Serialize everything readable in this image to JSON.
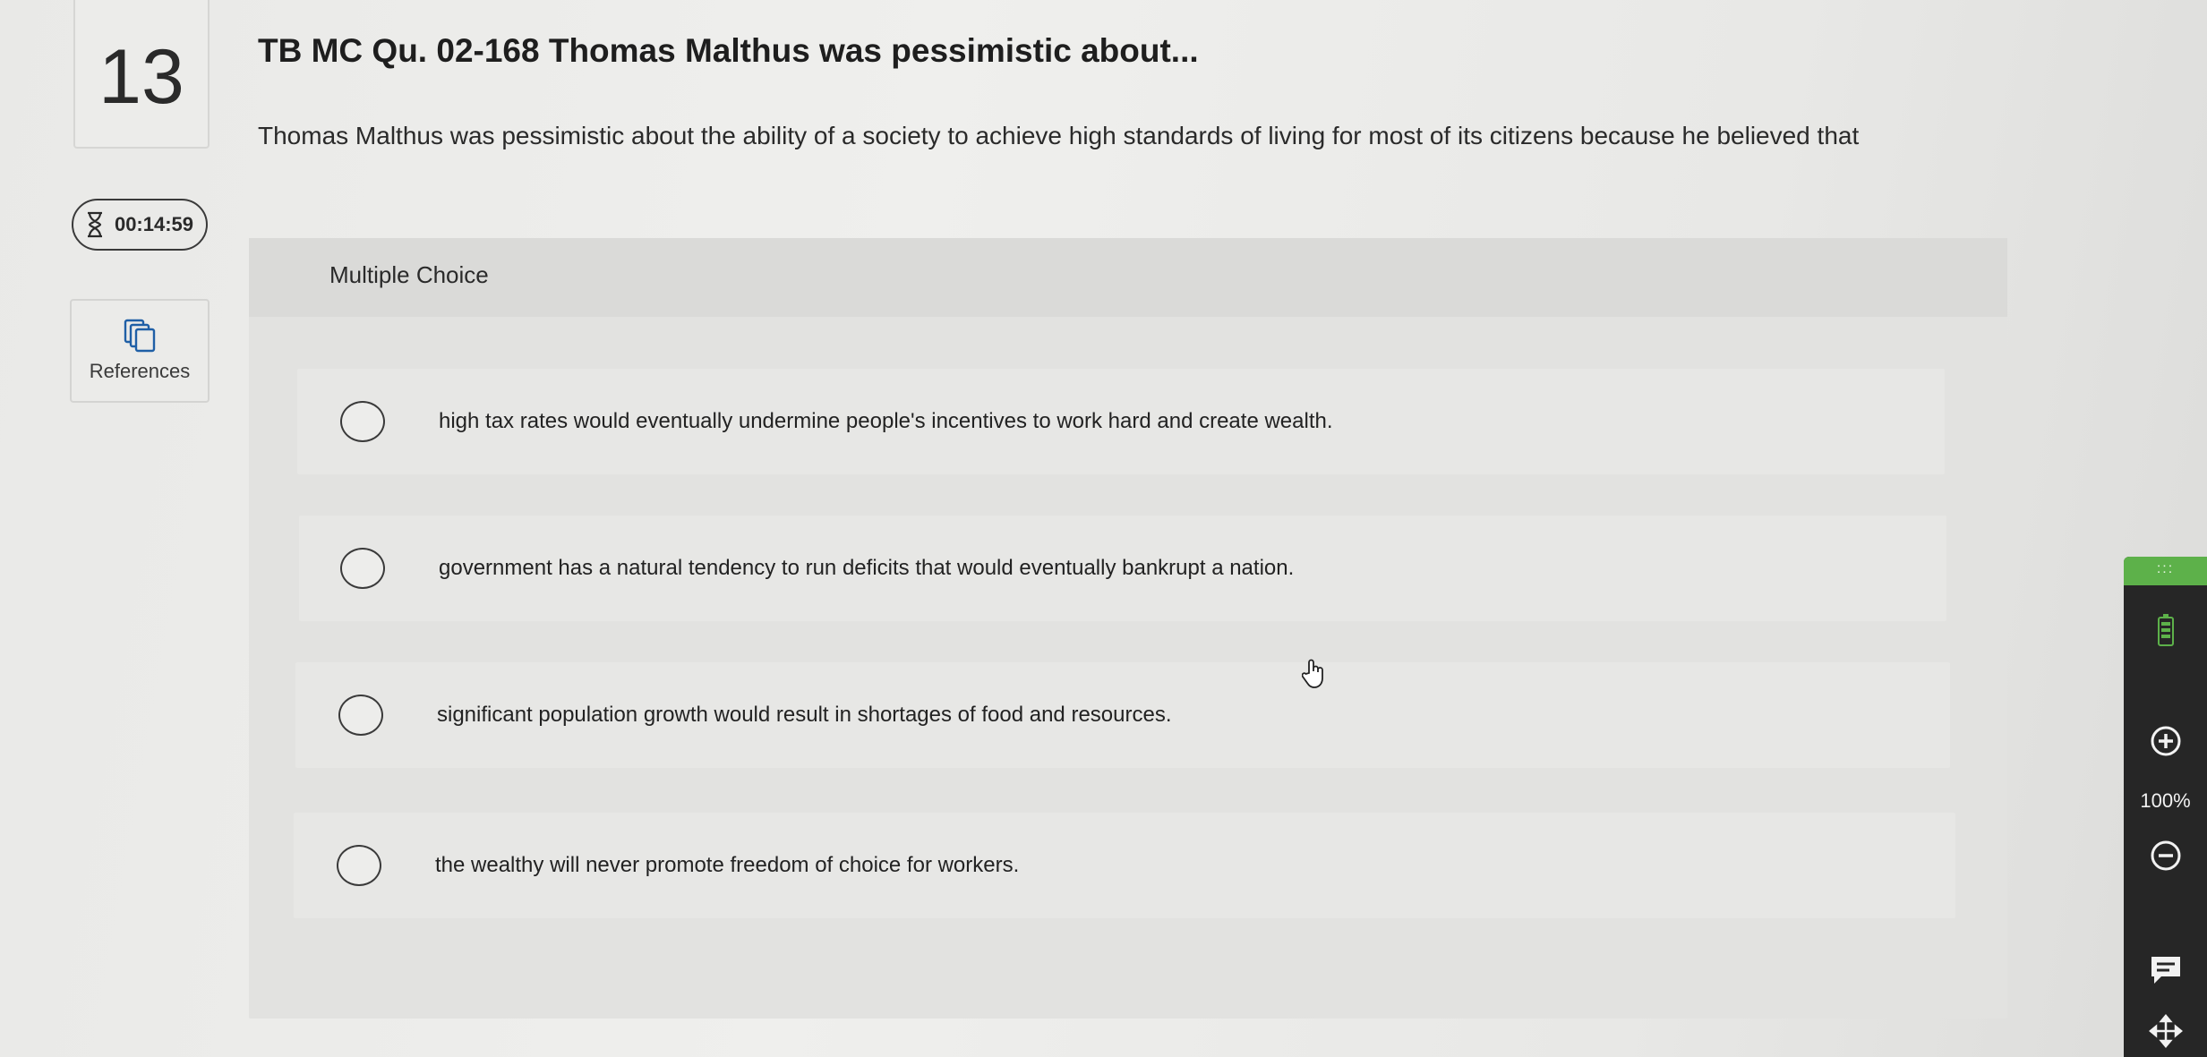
{
  "question": {
    "number": "13",
    "title": "TB MC Qu. 02-168 Thomas Malthus was pessimistic about...",
    "prompt": "Thomas Malthus was pessimistic about the ability of a society to achieve high standards of living for most of its citizens because he believed that"
  },
  "timer": {
    "icon": "hourglass-icon",
    "value": "00:14:59"
  },
  "references": {
    "icon": "copy-icon",
    "label": "References"
  },
  "multiple_choice": {
    "header": "Multiple Choice",
    "options": [
      {
        "text": "high tax rates would eventually undermine people's incentives to work hard and create wealth.",
        "selected": false
      },
      {
        "text": "government has a natural tendency to run deficits that would eventually bankrupt a nation.",
        "selected": false
      },
      {
        "text": "significant population growth would result in shortages of food and resources.",
        "selected": false
      },
      {
        "text": "the wealthy will never promote freedom of choice for workers.",
        "selected": false
      }
    ]
  },
  "toolbar": {
    "grip": ":::",
    "zoom_level": "100%",
    "icons": [
      "battery-icon",
      "zoom-in-icon",
      "zoom-out-icon",
      "comment-icon",
      "move-icon"
    ]
  },
  "colors": {
    "accent": "#5db14a",
    "toolbar_bg": "#262626",
    "panel_bg": "#e2e2e0"
  }
}
